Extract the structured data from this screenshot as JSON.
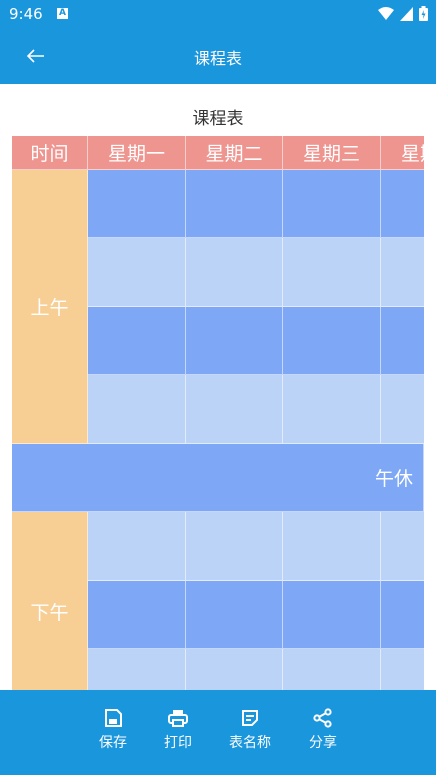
{
  "status_bar": {
    "time": "9:46",
    "notification_letter": "A"
  },
  "app_bar": {
    "title": "课程表"
  },
  "sheet": {
    "title": "课程表",
    "headers": [
      "时间",
      "星期一",
      "星期二",
      "星期三",
      "星期四"
    ],
    "morning_label": "上午",
    "lunch_label": "午休",
    "afternoon_label": "下午"
  },
  "bottom_nav": [
    {
      "label": "保存",
      "icon": "save-icon"
    },
    {
      "label": "打印",
      "icon": "print-icon"
    },
    {
      "label": "表名称",
      "icon": "rename-icon"
    },
    {
      "label": "分享",
      "icon": "share-icon"
    }
  ],
  "colors": {
    "primary": "#1a96dc",
    "header": "#ef9590",
    "period": "#f7cf95",
    "cell_dark": "#7ea8f5",
    "cell_light": "#bcd3f8"
  }
}
